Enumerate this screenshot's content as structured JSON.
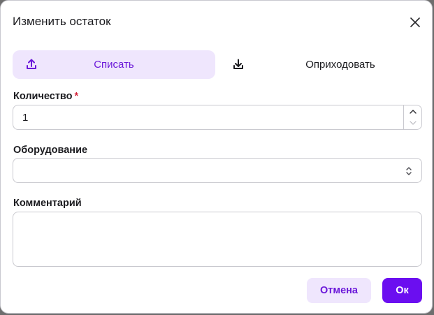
{
  "dialog": {
    "title": "Изменить остаток"
  },
  "mode_toggle": {
    "writeoff_label": "Списать",
    "receive_label": "Оприходовать",
    "active": "writeoff"
  },
  "quantity": {
    "label": "Количество",
    "required_mark": "*",
    "value": "1"
  },
  "equipment": {
    "label": "Оборудование",
    "value": ""
  },
  "comment": {
    "label": "Комментарий",
    "value": ""
  },
  "actions": {
    "cancel_label": "Отмена",
    "ok_label": "Ок"
  },
  "colors": {
    "accent": "#6b0ef0",
    "accent_text": "#6b18d9",
    "accent_light": "#efe6fd",
    "required": "#d4233a",
    "border": "#c9c9cf"
  },
  "icons": {
    "writeoff": "upload-icon",
    "receive": "download-icon",
    "close": "close-icon",
    "stepper_up": "chevron-up-icon",
    "stepper_down": "chevron-down-icon",
    "select": "select-chevrons-icon"
  }
}
